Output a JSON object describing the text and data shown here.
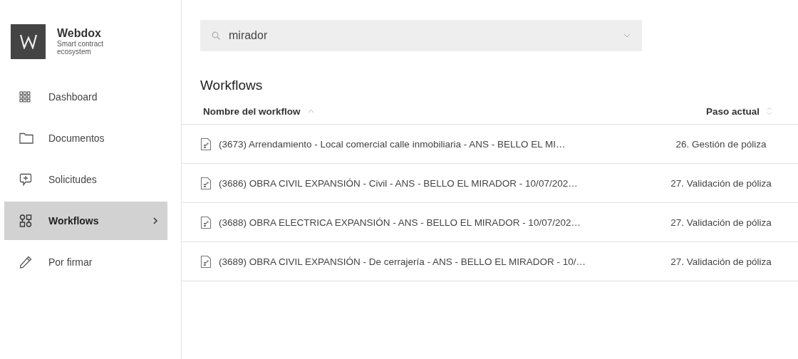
{
  "brand": {
    "name": "Webdox",
    "tagline": "Smart contract ecosystem"
  },
  "sidebar": {
    "items": [
      {
        "label": "Dashboard",
        "selected": false
      },
      {
        "label": "Documentos",
        "selected": false
      },
      {
        "label": "Solicitudes",
        "selected": false
      },
      {
        "label": "Workflows",
        "selected": true
      },
      {
        "label": "Por firmar",
        "selected": false
      }
    ]
  },
  "search": {
    "value": "mirador"
  },
  "section_title": "Workflows",
  "table": {
    "columns": [
      {
        "label": "Nombre del workflow",
        "sorted": true
      },
      {
        "label": "Paso actual",
        "sorted": false
      }
    ],
    "rows": [
      {
        "name": "(3673) Arrendamiento - Local comercial calle inmobiliaria - ANS - BELLO EL MI…",
        "step": "26. Gestión de póliza"
      },
      {
        "name": "(3686) OBRA CIVIL EXPANSIÓN - Civil - ANS - BELLO EL MIRADOR - 10/07/202…",
        "step": "27. Validación de póliza"
      },
      {
        "name": "(3688) OBRA ELECTRICA EXPANSIÓN - ANS - BELLO EL MIRADOR - 10/07/202…",
        "step": "27. Validación de póliza"
      },
      {
        "name": "(3689) OBRA CIVIL EXPANSIÓN - De cerrajería - ANS - BELLO EL MIRADOR - 10/…",
        "step": "27. Validación de póliza"
      }
    ]
  }
}
